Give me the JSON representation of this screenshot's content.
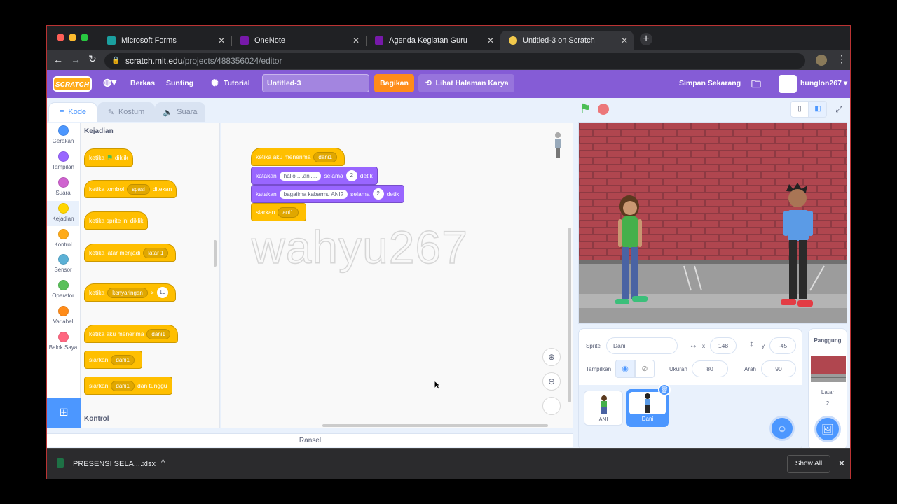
{
  "browser": {
    "tabs": [
      {
        "label": "Microsoft Forms",
        "color": "#1ba0a0"
      },
      {
        "label": "OneNote",
        "color": "#7719aa"
      },
      {
        "label": "Agenda Kegiatan Guru",
        "color": "#7719aa"
      },
      {
        "label": "Untitled-3 on Scratch",
        "color": "#f2c94c"
      }
    ],
    "url_domain": "scratch.mit.edu",
    "url_path": "/projects/488356024/editor"
  },
  "menu": {
    "logo": "SCRATCH",
    "berkas": "Berkas",
    "sunting": "Sunting",
    "tutorial": "Tutorial",
    "project_title": "Untitled-3",
    "bagikan": "Bagikan",
    "lihat": "Lihat Halaman Karya",
    "simpan": "Simpan Sekarang",
    "username": "bunglon267"
  },
  "editor_tabs": {
    "kode": "Kode",
    "kostum": "Kostum",
    "suara": "Suara"
  },
  "categories": [
    {
      "label": "Gerakan",
      "color": "#4c97ff"
    },
    {
      "label": "Tampilan",
      "color": "#9966ff"
    },
    {
      "label": "Suara",
      "color": "#cf63cf"
    },
    {
      "label": "Kejadian",
      "color": "#ffd500"
    },
    {
      "label": "Kontrol",
      "color": "#ffab19"
    },
    {
      "label": "Sensor",
      "color": "#5cb1d6"
    },
    {
      "label": "Operator",
      "color": "#59c059"
    },
    {
      "label": "Variabel",
      "color": "#ff8c1a"
    },
    {
      "label": "Balok Saya",
      "color": "#ff6680"
    }
  ],
  "palette": {
    "heading": "Kejadian",
    "next_heading": "Kontrol",
    "b1_a": "ketika",
    "b1_b": "diklik",
    "b2_a": "ketika tombol",
    "b2_dd": "spasi",
    "b2_b": "ditekan",
    "b3": "ketika sprite ini diklik",
    "b4_a": "ketika latar menjadi",
    "b4_dd": "latar 1",
    "b5_a": "ketika",
    "b5_dd": "kenyaringan",
    "b5_op": ">",
    "b5_val": "10",
    "b6_a": "ketika aku menerima",
    "b6_dd": "dani1",
    "b7_a": "siarkan",
    "b7_dd": "dani1",
    "b8_a": "siarkan",
    "b8_dd": "dani1",
    "b8_b": "dan tunggu"
  },
  "script": {
    "hat_a": "ketika aku menerima",
    "hat_dd": "dani1",
    "say1_a": "katakan",
    "say1_msg": "hallo ....ani....",
    "say1_mid": "selama",
    "say1_n": "2",
    "say1_b": "detik",
    "say2_a": "katakan",
    "say2_msg": "bagaiima kabarmu ANI?",
    "say2_mid": "selama",
    "say2_n": "2",
    "say2_b": "detik",
    "bc_a": "siarkan",
    "bc_dd": "ani1"
  },
  "watermark": "wahyu267",
  "backpack": "Ransel",
  "sprite_info": {
    "sprite_label": "Sprite",
    "sprite_name": "Dani",
    "x_label": "x",
    "x": "148",
    "y_label": "y",
    "y": "-45",
    "show_label": "Tampilkan",
    "size_label": "Ukuran",
    "size": "80",
    "dir_label": "Arah",
    "dir": "90"
  },
  "sprites": [
    {
      "name": "ANI",
      "selected": false
    },
    {
      "name": "Dani",
      "selected": true
    }
  ],
  "stage_panel": {
    "title": "Panggung",
    "latar_label": "Latar",
    "latar_count": "2"
  },
  "download": {
    "file": "PRESENSI SELA....xlsx",
    "show_all": "Show All"
  },
  "colors": {
    "scratch_purple": "#855cd6",
    "events": "#ffbf00",
    "looks": "#9966ff",
    "share_orange": "#ff8c1a",
    "accent_blue": "#4c97ff"
  }
}
